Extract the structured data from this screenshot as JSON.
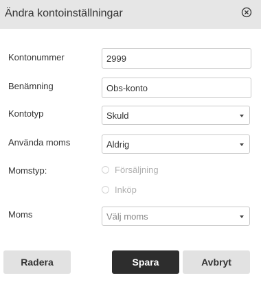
{
  "dialog": {
    "title": "Ändra kontoinställningar",
    "close_icon": "close-circle-icon"
  },
  "form": {
    "account_number": {
      "label": "Kontonummer",
      "value": "2999"
    },
    "name": {
      "label": "Benämning",
      "value": "Obs-konto"
    },
    "account_type": {
      "label": "Kontotyp",
      "value": "Skuld"
    },
    "use_vat": {
      "label": "Använda moms",
      "value": "Aldrig"
    },
    "vat_type": {
      "label": "Momstyp:",
      "options": [
        "Försäljning",
        "Inköp"
      ]
    },
    "vat": {
      "label": "Moms",
      "placeholder": "Välj moms"
    }
  },
  "buttons": {
    "delete": "Radera",
    "save": "Spara",
    "cancel": "Avbryt"
  },
  "colors": {
    "header_bg": "#e6e6e6",
    "primary_button": "#2d2d2d",
    "secondary_button": "#e2e2e2"
  }
}
